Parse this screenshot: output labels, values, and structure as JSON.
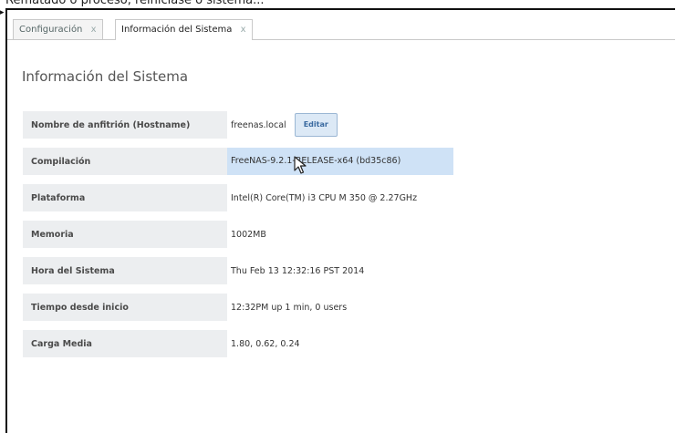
{
  "caption": "Rematado o proceso, reiniciase o sistema...",
  "tabs": [
    {
      "label": "Configuración",
      "close": "x",
      "active": false
    },
    {
      "label": "Información del Sistema",
      "close": "x",
      "active": true
    }
  ],
  "panel": {
    "title": "Información del Sistema",
    "rows": [
      {
        "label": "Nombre de anfitrión (Hostname)",
        "value": "freenas.local"
      },
      {
        "label": "Compilación",
        "value": "FreeNAS-9.2.1-RELEASE-x64 (bd35c86)"
      },
      {
        "label": "Plataforma",
        "value": "Intel(R) Core(TM) i3 CPU M 350 @ 2.27GHz"
      },
      {
        "label": "Memoria",
        "value": "1002MB"
      },
      {
        "label": "Hora del Sistema",
        "value": "Thu Feb 13 12:32:16 PST 2014"
      },
      {
        "label": "Tiempo desde inicio",
        "value": "12:32PM up 1 min, 0 users"
      },
      {
        "label": "Carga Media",
        "value": "1.80, 0.62, 0.24"
      }
    ],
    "edit_label": "Editar"
  },
  "colors": {
    "label_bg": "#eceef0",
    "highlight_bg": "#cfe2f6",
    "button_bg": "#dce9f6"
  },
  "icons": {
    "cursor": "mouse-pointer-icon",
    "close": "close-icon"
  }
}
